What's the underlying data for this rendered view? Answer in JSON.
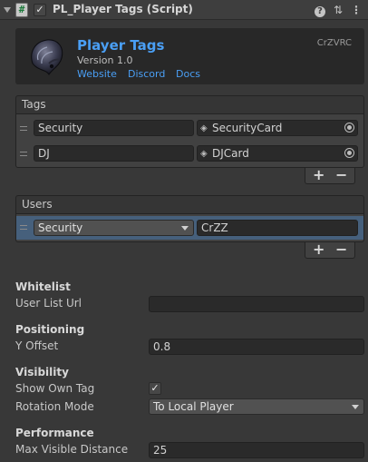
{
  "header": {
    "script_icon": "#",
    "enabled_check": "✓",
    "title": "PL_Player Tags (Script)",
    "icons": [
      "help-icon",
      "presets-icon",
      "more-icon"
    ],
    "help_glyph": "?",
    "presets_glyph": "⇅",
    "more_glyph": "⋮"
  },
  "banner": {
    "title": "Player Tags",
    "version": "Version 1.0",
    "links": [
      "Website",
      "Discord",
      "Docs"
    ],
    "author": "CrZVRC",
    "logo": "alien-head-logo",
    "link_color": "#4a9ff5"
  },
  "tags": {
    "header": "Tags",
    "rows": [
      {
        "tag": "Security",
        "object": "SecurityCard"
      },
      {
        "tag": "DJ",
        "object": "DJCard"
      }
    ],
    "add": "+",
    "remove": "−"
  },
  "users": {
    "header": "Users",
    "rows": [
      {
        "tag": "Security",
        "user": "CrZZ"
      }
    ],
    "add": "+",
    "remove": "−"
  },
  "whitelist": {
    "section": "Whitelist",
    "user_list_url_label": "User List Url",
    "user_list_url_value": ""
  },
  "positioning": {
    "section": "Positioning",
    "y_offset_label": "Y Offset",
    "y_offset_value": "0.8"
  },
  "visibility": {
    "section": "Visibility",
    "show_own_tag_label": "Show Own Tag",
    "show_own_tag_check": "✓",
    "rotation_mode_label": "Rotation Mode",
    "rotation_mode_value": "To Local Player"
  },
  "performance": {
    "section": "Performance",
    "max_visible_distance_label": "Max Visible Distance",
    "max_visible_distance_value": "25"
  },
  "colors": {
    "background": "#383838",
    "field": "#2a2a2a",
    "accent_link": "#4a9ff5",
    "selected_row": "#46607c"
  }
}
